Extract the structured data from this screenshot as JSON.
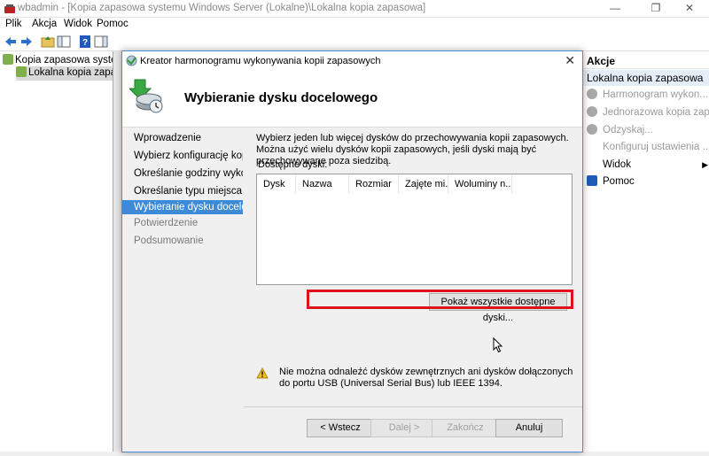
{
  "window": {
    "title": "wbadmin - [Kopia zapasowa systemu Windows Server (Lokalne)\\Lokalna kopia zapasowa]",
    "minimize": "—",
    "maximize": "❐",
    "close": "✕"
  },
  "menu": [
    "Plik",
    "Akcja",
    "Widok",
    "Pomoc"
  ],
  "tree": {
    "root": "Kopia zapasowa systemu W",
    "child": "Lokalna kopia zapasow"
  },
  "actions": {
    "header": "Akcje",
    "section": "Lokalna kopia zapasowa",
    "items": [
      {
        "label": "Harmonogram wykon...",
        "enabled": false,
        "icon": "schedule-icon"
      },
      {
        "label": "Jednorazowa kopia zap...",
        "enabled": false,
        "icon": "backup-once-icon"
      },
      {
        "label": "Odzyskaj...",
        "enabled": false,
        "icon": "recover-icon"
      },
      {
        "label": "Konfiguruj ustawienia ...",
        "enabled": false,
        "icon": "none"
      },
      {
        "label": "Widok",
        "enabled": true,
        "icon": "none",
        "submenu": "▶"
      },
      {
        "label": "Pomoc",
        "enabled": true,
        "icon": "help-icon"
      }
    ]
  },
  "dialog": {
    "title": "Kreator harmonogramu wykonywania kopii zapasowych",
    "close": "✕",
    "heading": "Wybieranie dysku docelowego",
    "steps": [
      {
        "label": "Wprowadzenie",
        "state": "done"
      },
      {
        "label": "Wybierz konfigurację kop...",
        "state": "done"
      },
      {
        "label": "Określanie godziny wyko...",
        "state": "done"
      },
      {
        "label": "Określanie typu miejsca d...",
        "state": "done"
      },
      {
        "label": "Wybieranie dysku docelo...",
        "state": "active"
      },
      {
        "label": "Potwierdzenie",
        "state": "future"
      },
      {
        "label": "Podsumowanie",
        "state": "future"
      }
    ],
    "description": "Wybierz jeden lub więcej dysków do przechowywania kopii zapasowych. Można użyć wielu dysków kopii zapasowych, jeśli dyski mają być przechowywane poza siedzibą.",
    "available_label": "Dostępne dyski:",
    "columns": [
      "Dysk",
      "Nazwa",
      "Rozmiar",
      "Zajęte mi...",
      "Woluminy n..."
    ],
    "show_all_button": "Pokaż wszystkie dostępne dyski...",
    "warning": "Nie można odnaleźć dysków zewnętrznych ani dysków dołączonych do portu USB (Universal Serial Bus) lub IEEE 1394.",
    "buttons": {
      "back": "< Wstecz",
      "next": "Dalej >",
      "finish": "Zakończ",
      "cancel": "Anuluj"
    }
  },
  "colors": {
    "accent": "#3c8ad8",
    "highlight": "#e0101c"
  }
}
